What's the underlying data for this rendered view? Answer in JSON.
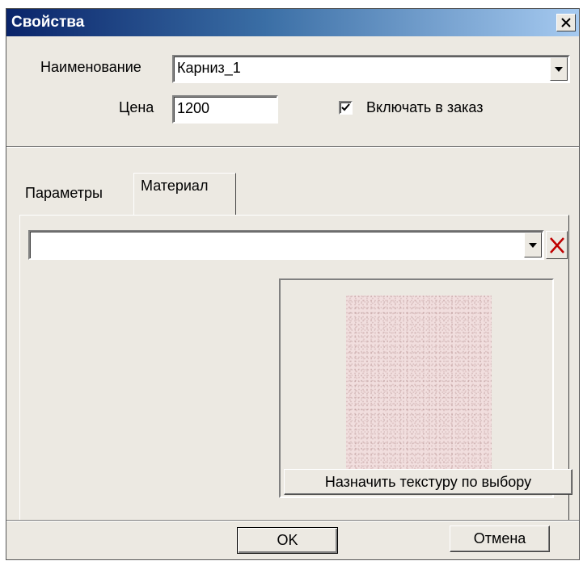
{
  "window": {
    "title": "Свойства"
  },
  "form": {
    "name_label": "Наименование",
    "name_value": "Карниз_1",
    "price_label": "Цена",
    "price_value": "1200",
    "include_label": "Включать в заказ",
    "include_checked": true
  },
  "tabs": [
    {
      "label": "Параметры",
      "active": false
    },
    {
      "label": "Материал",
      "active": true
    }
  ],
  "material": {
    "selected": "",
    "assign_texture_label": "Назначить текстуру по выбору"
  },
  "footer": {
    "ok_label": "OK",
    "cancel_label": "Отмена"
  },
  "colors": {
    "dialog_bg": "#ece9e2",
    "title_bar": "#0a246a",
    "texture": "#f1dede",
    "delete_icon": "#c00000"
  }
}
